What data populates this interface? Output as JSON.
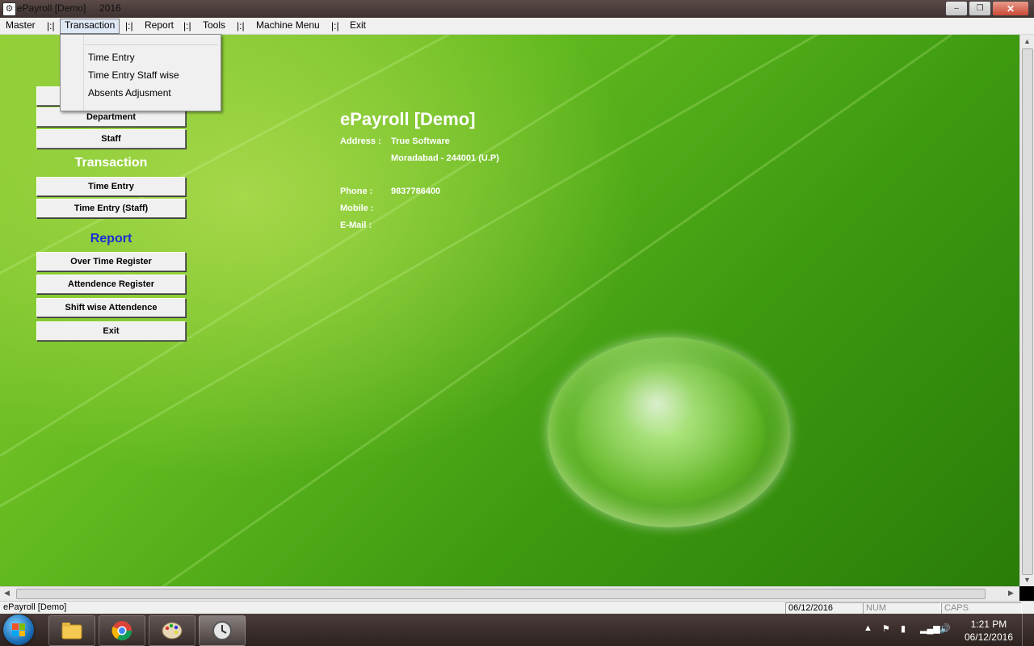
{
  "window": {
    "title": "ePayroll [Demo]",
    "year": "2016",
    "minimize": "–",
    "maximize": "❐",
    "close": "✕"
  },
  "menu": {
    "items": [
      "Master",
      "Transaction",
      "Report",
      "Tools",
      "Machine Menu",
      "Exit"
    ],
    "separator": "|:|",
    "active": "Transaction"
  },
  "dropdown": {
    "items": [
      "Time Entry",
      "Time Entry Staff wise",
      "Absents Adjusment"
    ]
  },
  "left_panel": {
    "master_buttons": [
      "Department",
      "Staff"
    ],
    "transaction_heading": "Transaction",
    "transaction_buttons": [
      "Time  Entry",
      "Time Entry (Staff)"
    ],
    "report_heading": "Report",
    "report_buttons": [
      "Over Time Register",
      "Attendence Register",
      "Shift wise Attendence",
      "Exit"
    ]
  },
  "company": {
    "name": "ePayroll [Demo]",
    "address_label": "Address :",
    "address_line1": "True Software",
    "address_line2": "Moradabad - 244001 (U.P)",
    "phone_label": "Phone   :",
    "phone_value": "9837786400",
    "mobile_label": "Mobile   :",
    "email_label": "E-Mail   :"
  },
  "statusbar": {
    "app": "ePayroll [Demo]",
    "date": "06/12/2016",
    "num": "NUM",
    "caps": "CAPS"
  },
  "taskbar": {
    "time": "1:21 PM",
    "date": "06/12/2016"
  },
  "colors": {
    "transaction_heading": "#ffffff",
    "report_heading": "#1a2fd4",
    "leaf_light": "#8fce35",
    "leaf_dark": "#2a7d08"
  }
}
